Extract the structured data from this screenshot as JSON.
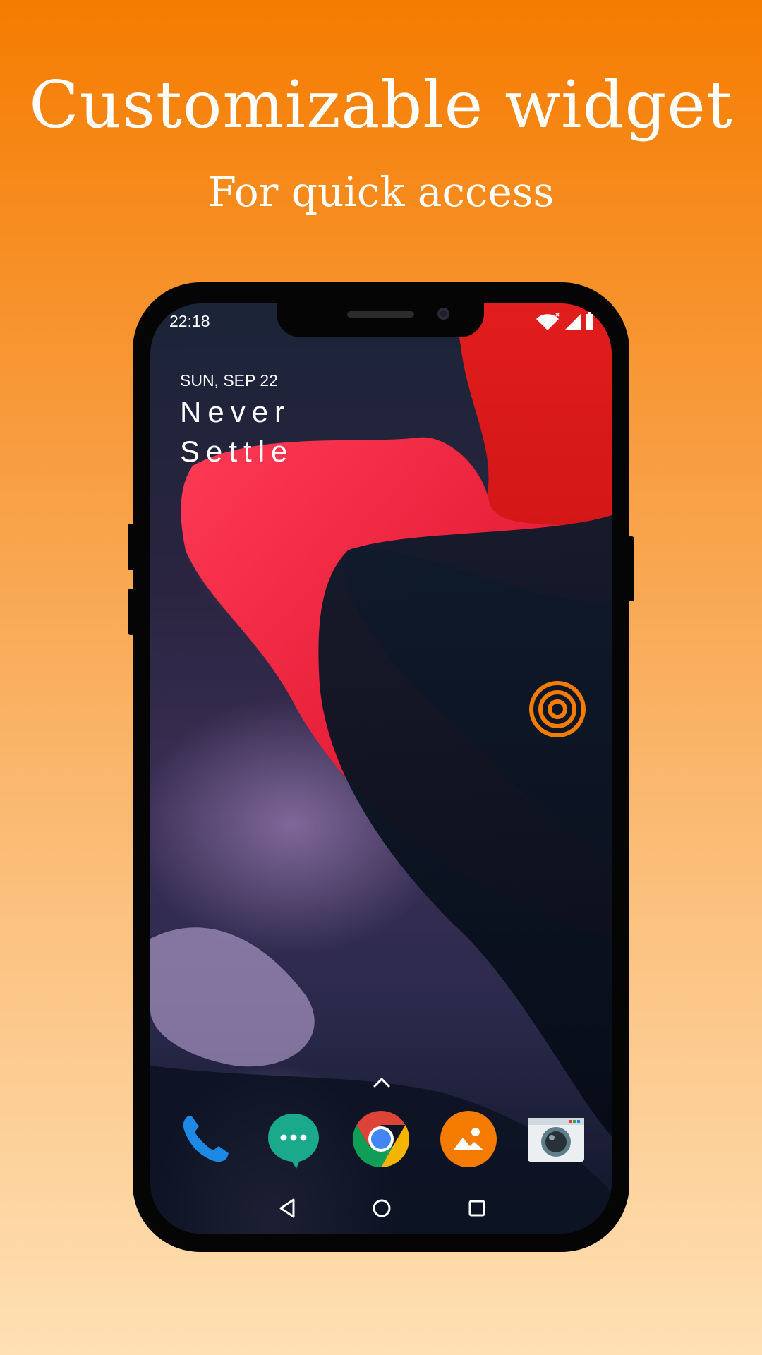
{
  "promo": {
    "headline": "Customizable widget",
    "subheadline": "For quick access"
  },
  "status_bar": {
    "time": "22:18",
    "icons": [
      "wifi-icon",
      "cell-signal-icon",
      "battery-icon"
    ]
  },
  "home_screen": {
    "date": "SUN, SEP 22",
    "tagline_line1": "Never",
    "tagline_line2": "Settle",
    "widget_icon": "concentric-rings-icon"
  },
  "dock": {
    "apps": [
      "phone",
      "messages",
      "chrome",
      "gallery",
      "camera"
    ]
  },
  "navigation": {
    "buttons": [
      "back",
      "home",
      "recents"
    ]
  },
  "colors": {
    "accent": "#f57c00",
    "background_top": "#f57c00",
    "background_bottom": "#fee0b4",
    "phone_frame": "#050505"
  }
}
